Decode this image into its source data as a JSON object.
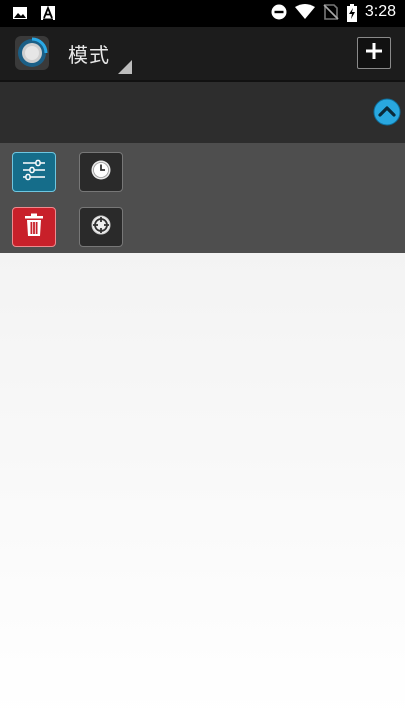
{
  "status_bar": {
    "time": "3:28",
    "left_icons": [
      "image-icon",
      "text-a-icon"
    ],
    "right_icons": [
      "do-not-disturb-icon",
      "wifi-icon",
      "no-sim-icon",
      "battery-charging-icon"
    ]
  },
  "app_bar": {
    "title": "模式",
    "logo_icon": "knob-logo-icon",
    "add_icon": "plus-icon"
  },
  "collapse": {
    "icon": "chevron-up-icon",
    "color": "#29a8e0"
  },
  "tools": [
    {
      "icon": "sliders-icon",
      "color": "#156d8a"
    },
    {
      "icon": "clock-icon",
      "color": "#2a2a2a"
    },
    {
      "icon": "trash-icon",
      "color": "#c8202a"
    },
    {
      "icon": "crosshair-icon",
      "color": "#2a2a2a"
    }
  ]
}
